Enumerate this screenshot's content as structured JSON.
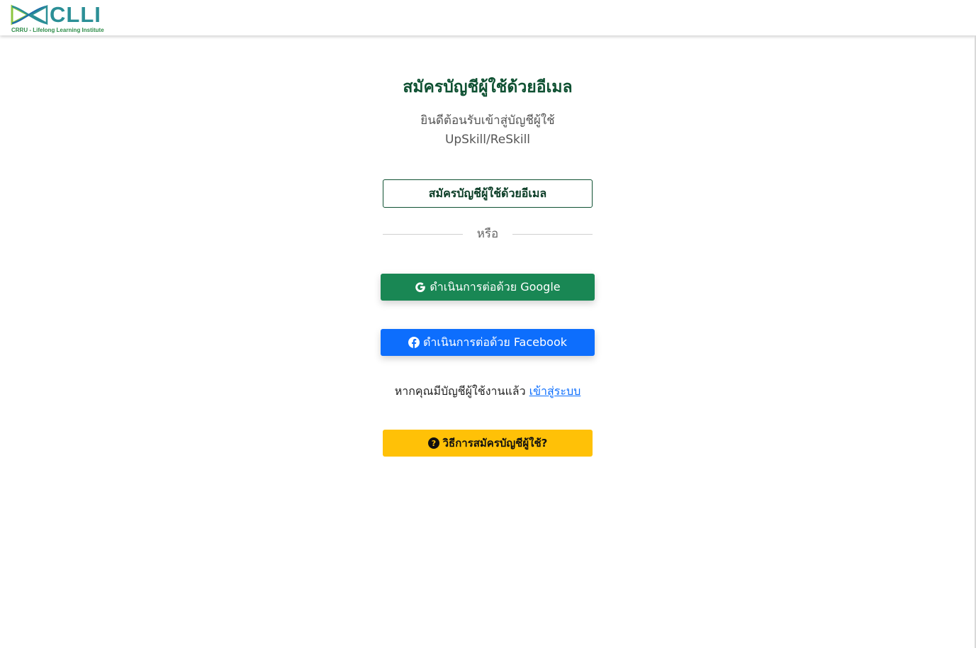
{
  "header": {
    "logo_text": "CLLI",
    "logo_subtitle": "CRRU - Lifelong Learning Institute"
  },
  "main": {
    "title": "สมัครบัญชีผู้ใช้ด้วยอีเมล",
    "subtitle_line1": "ยินดีต้อนรับเข้าสู่บัญชีผู้ใช้",
    "subtitle_line2": "UpSkill/ReSkill",
    "email_button_label": "สมัครบัญชีผู้ใช้ด้วยอีเมล",
    "divider_text": "หรือ",
    "google_button_label": "ดำเนินการต่อด้วย Google",
    "facebook_button_label": "ดำเนินการต่อด้วย Facebook",
    "login_prompt": "หากคุณมีบัญชีผู้ใช้งานแล้ว",
    "login_link": "เข้าสู่ระบบ",
    "help_button_label": "วิธีการสมัครบัญชีผู้ใช้?"
  },
  "colors": {
    "brand_green": "#0f5132",
    "google_button": "#198754",
    "facebook_button": "#0d6efd",
    "help_button": "#ffc107",
    "logo_teal": "#2b8f96"
  },
  "icons": {
    "google": "google-icon",
    "facebook": "facebook-icon",
    "help": "question-circle-icon"
  }
}
